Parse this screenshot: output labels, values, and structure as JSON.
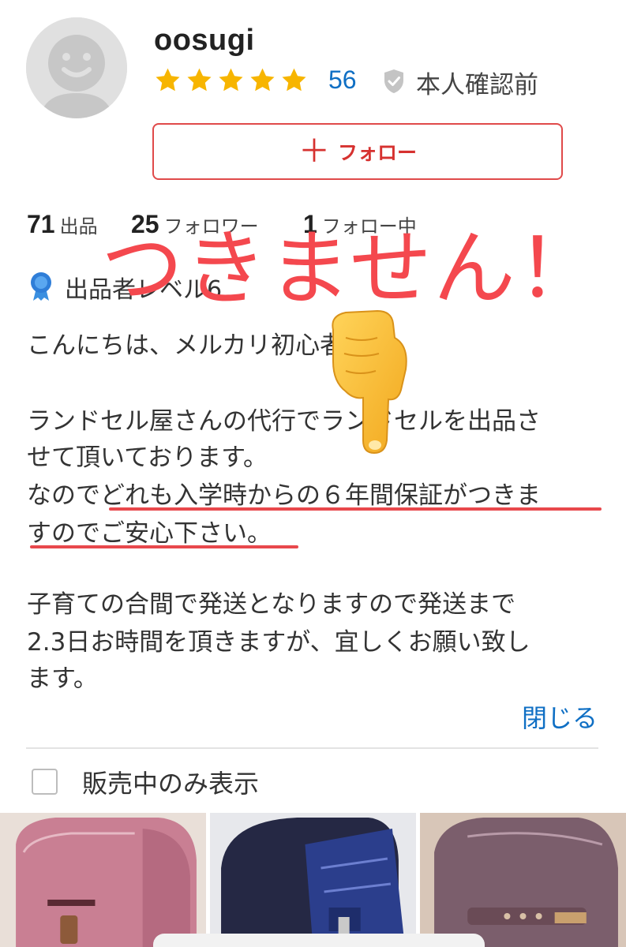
{
  "profile": {
    "username": "oosugi",
    "rating_stars": 5,
    "rating_count": "56",
    "verification_status": "本人確認前",
    "follow_button_label": "フォロー"
  },
  "stats": {
    "listings": {
      "count": "71",
      "label": "出品"
    },
    "followers": {
      "count": "25",
      "label": "フォロワー"
    },
    "following": {
      "count": "1",
      "label": "フォロー中"
    }
  },
  "seller_level": "出品者レベル6",
  "bio": {
    "lines": [
      "こんにちは、メルカリ初心者です。",
      "",
      "ランドセル屋さんの代行でランドセルを出品さ",
      "せて頂いております。",
      "なのでどれも入学時からの６年間保証がつきま",
      "すのでご安心下さい。",
      "",
      "子育ての合間で発送となりますので発送まで",
      "2.3日お時間を頂きますが、宜しくお願い致し",
      "ます。"
    ]
  },
  "overlay": {
    "text": "つきません！",
    "color": "#f4484e"
  },
  "close_link": "閉じる",
  "filter": {
    "label": "販売中のみ表示",
    "checked": false
  },
  "items": [
    {
      "icon": "pink-randoseru-photo"
    },
    {
      "icon": "navy-randoseru-photo"
    },
    {
      "icon": "mauve-randoseru-photo"
    }
  ],
  "colors": {
    "accent": "#d6312f",
    "link": "#0f6fc4",
    "star": "#f7b500",
    "annotation": "#f4484e"
  }
}
